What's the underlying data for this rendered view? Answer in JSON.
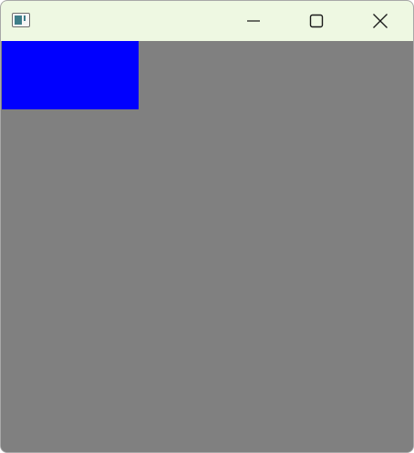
{
  "window": {
    "title": "",
    "titlebar_color": "#eef8e2",
    "client_background": "#808080",
    "icons": {
      "app": "app-window-icon",
      "minimize": "minimize-icon",
      "maximize": "maximize-icon",
      "close": "close-icon"
    }
  },
  "canvas": {
    "shapes": [
      {
        "kind": "rectangle",
        "color": "#0000ff"
      }
    ]
  }
}
